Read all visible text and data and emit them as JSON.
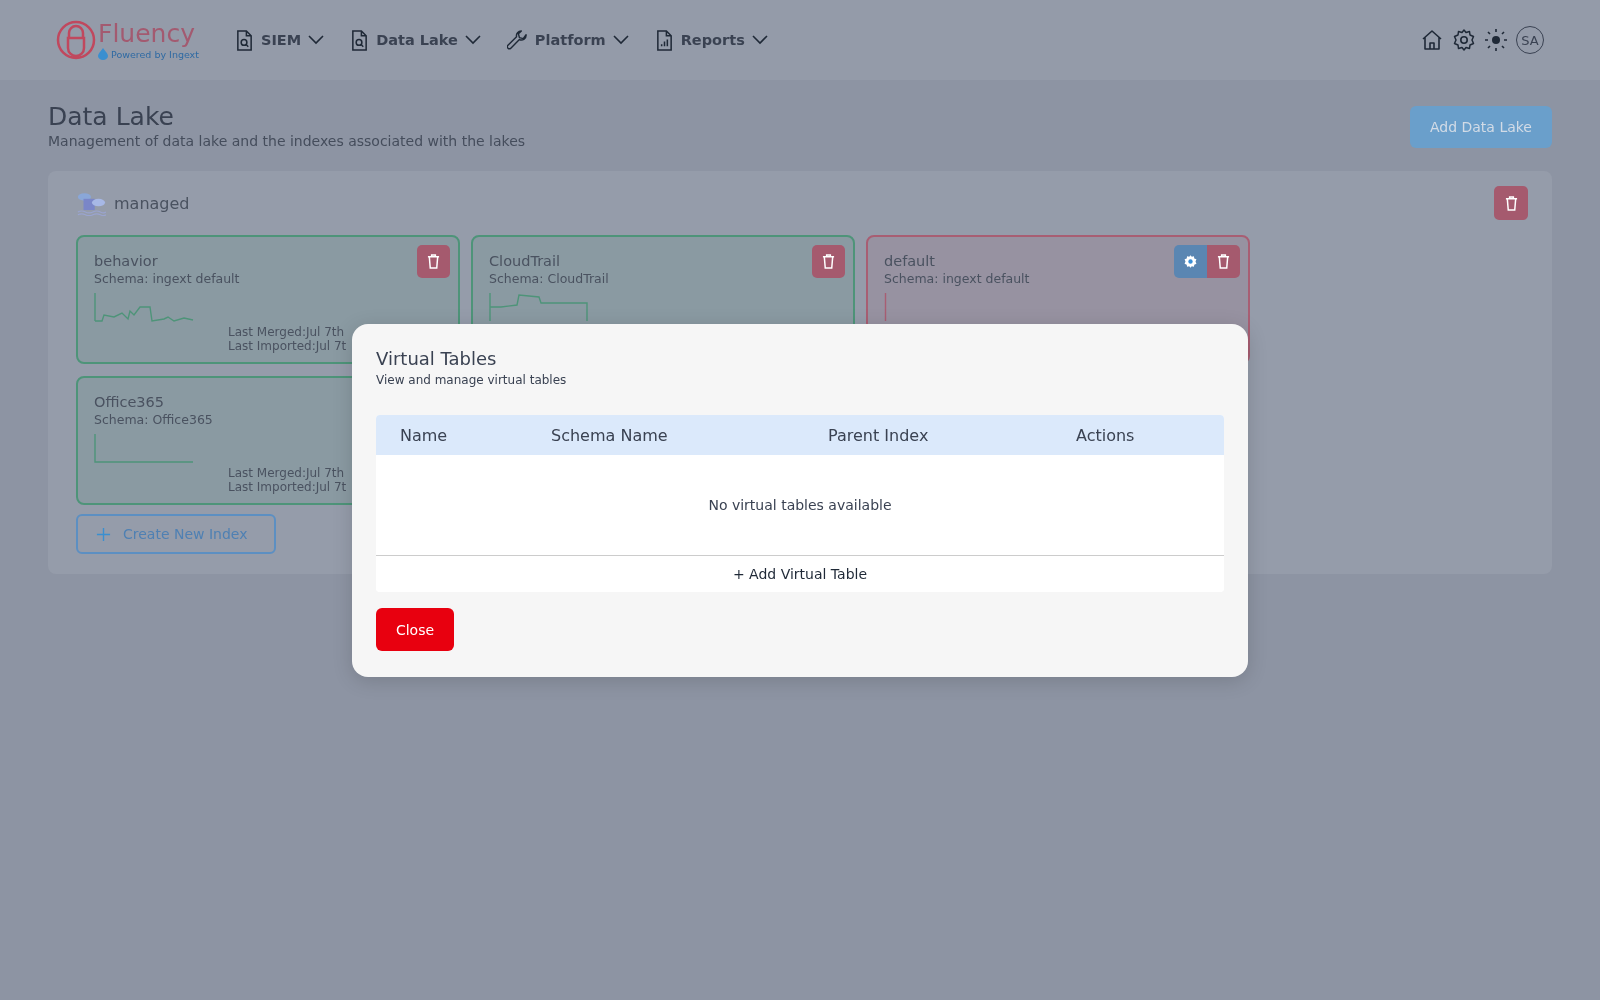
{
  "header": {
    "logo": {
      "name": "Fluency",
      "tagline": "Powered by Ingext"
    },
    "nav": [
      {
        "label": "SIEM",
        "kind": "search-doc"
      },
      {
        "label": "Data Lake",
        "kind": "search-doc"
      },
      {
        "label": "Platform",
        "kind": "wrench"
      },
      {
        "label": "Reports",
        "kind": "chart-doc"
      }
    ],
    "avatar": "SA"
  },
  "page": {
    "title": "Data Lake",
    "subtitle": "Management of data lake and the indexes associated with the lakes",
    "add_button": "Add Data Lake"
  },
  "lake": {
    "name": "managed",
    "indexes": [
      {
        "name": "behavior",
        "schema": "Schema: ingext default",
        "color": "#4e9479",
        "settings": false,
        "last_merged": "Last Merged:Jul 7th",
        "last_imported": "Last Imported:Jul 7t"
      },
      {
        "name": "CloudTrail",
        "schema": "Schema: CloudTrail",
        "color": "#4e9479",
        "settings": false
      },
      {
        "name": "default",
        "schema": "Schema: ingext default",
        "color": "#a85e73",
        "settings": true
      },
      {
        "name": "Office365",
        "schema": "Schema: Office365",
        "color": "#4e9479",
        "settings": false,
        "last_merged": "Last Merged:Jul 7th",
        "last_imported": "Last Imported:Jul 7t"
      }
    ],
    "create_button": "Create New Index"
  },
  "modal": {
    "title": "Virtual Tables",
    "subtitle": "View and manage virtual tables",
    "columns": [
      "Name",
      "Schema Name",
      "Parent Index",
      "Actions"
    ],
    "empty_message": "No virtual tables available",
    "add_row": "+ Add Virtual Table",
    "close_button": "Close"
  }
}
